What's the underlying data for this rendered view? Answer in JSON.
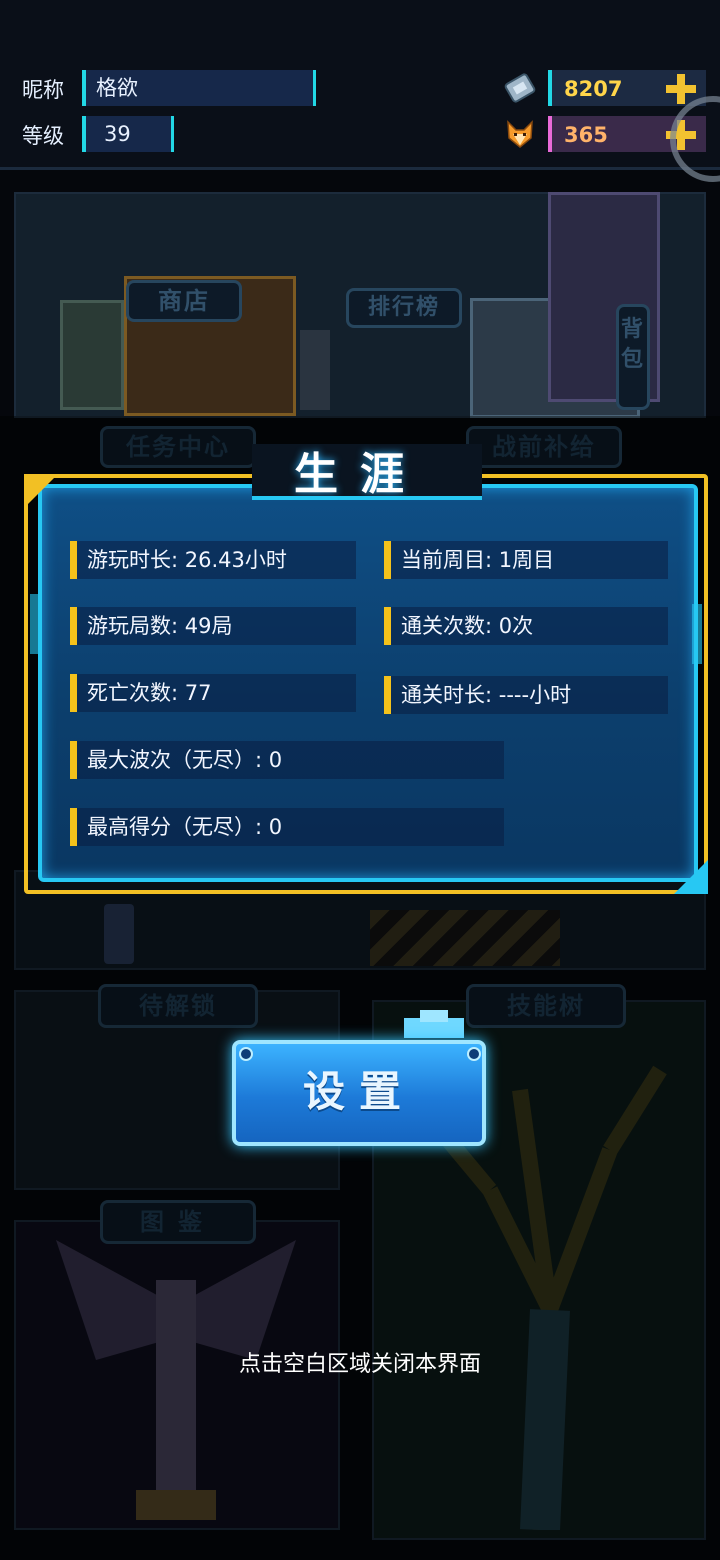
{
  "header": {
    "nickname_label": "昵称",
    "nickname": "格欲",
    "level_label": "等级",
    "level": "39",
    "gold": "8207",
    "gems": "365",
    "gold_icon": "ticket-icon",
    "gem_icon": "fox-face-icon"
  },
  "scene": {
    "shop": "商店",
    "leaderboard": "排行榜",
    "backpack": "背包",
    "task_center": "任务中心",
    "supplies": "战前补给",
    "locked": "待解锁",
    "skill_tree": "技能树",
    "codex": "图鉴"
  },
  "career": {
    "title": "生涯",
    "stats": [
      {
        "label": "游玩时长",
        "value": "26.43小时"
      },
      {
        "label": "当前周目",
        "value": "1周目"
      },
      {
        "label": "游玩局数",
        "value": "49局"
      },
      {
        "label": "通关次数",
        "value": "0次"
      },
      {
        "label": "死亡次数",
        "value": "77"
      },
      {
        "label": "通关时长",
        "value": "----小时"
      },
      {
        "label": "最大波次（无尽）",
        "value": "0"
      },
      {
        "label": "最高得分（无尽）",
        "value": "0"
      }
    ]
  },
  "settings_button": "设置",
  "hint": "点击空白区域关闭本界面",
  "colors": {
    "accent_cyan": "#27c8f3",
    "accent_gold": "#f4c21b",
    "panel_blue": "#0f4f86"
  }
}
